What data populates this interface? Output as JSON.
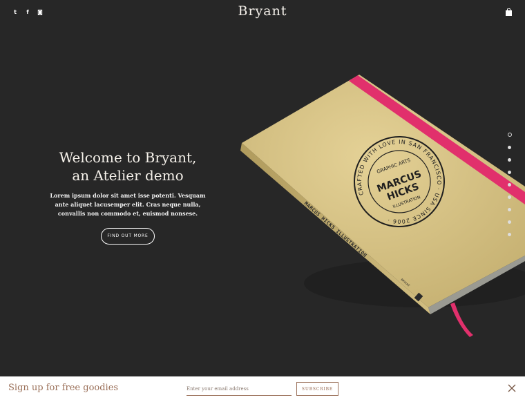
{
  "header": {
    "logo": "Bryant",
    "social": [
      {
        "icon": "twitter-icon",
        "glyph": "t"
      },
      {
        "icon": "facebook-icon",
        "glyph": "f"
      },
      {
        "icon": "instagram-icon",
        "glyph": "◙"
      }
    ]
  },
  "hero": {
    "title_line1": "Welcome to Bryant,",
    "title_line2": "an Atelier demo",
    "text": "Lorem ipsum dolor sit amet isse potenti. Vesquam ante aliquet lacusemper elit. Cras neque nulla, convallis non commodo et, euismod nonsese.",
    "cta": "FIND OUT MORE",
    "slides": {
      "count": 9,
      "active": 1
    },
    "book": {
      "spine_text": "MARCUS HICKS ILLUSTRATION",
      "spine_small": "BRYANT",
      "stamp_ring": "CRAFTED WITH LOVE IN SAN FRANCISCO · USA SINCE 2006 ·",
      "stamp_inner_top": "GRAPHIC ARTS",
      "stamp_name1": "MARCUS",
      "stamp_name2": "HICKS",
      "stamp_inner_bottom": "ILLUSTRATION"
    }
  },
  "signup": {
    "title": "Sign up for free goodies",
    "email_placeholder": "Enter your email address",
    "button": "SUBSCRIBE"
  },
  "colors": {
    "accent": "#9a6f58",
    "background": "#272727",
    "band": "#e8215a",
    "cover": "#d8c489"
  }
}
